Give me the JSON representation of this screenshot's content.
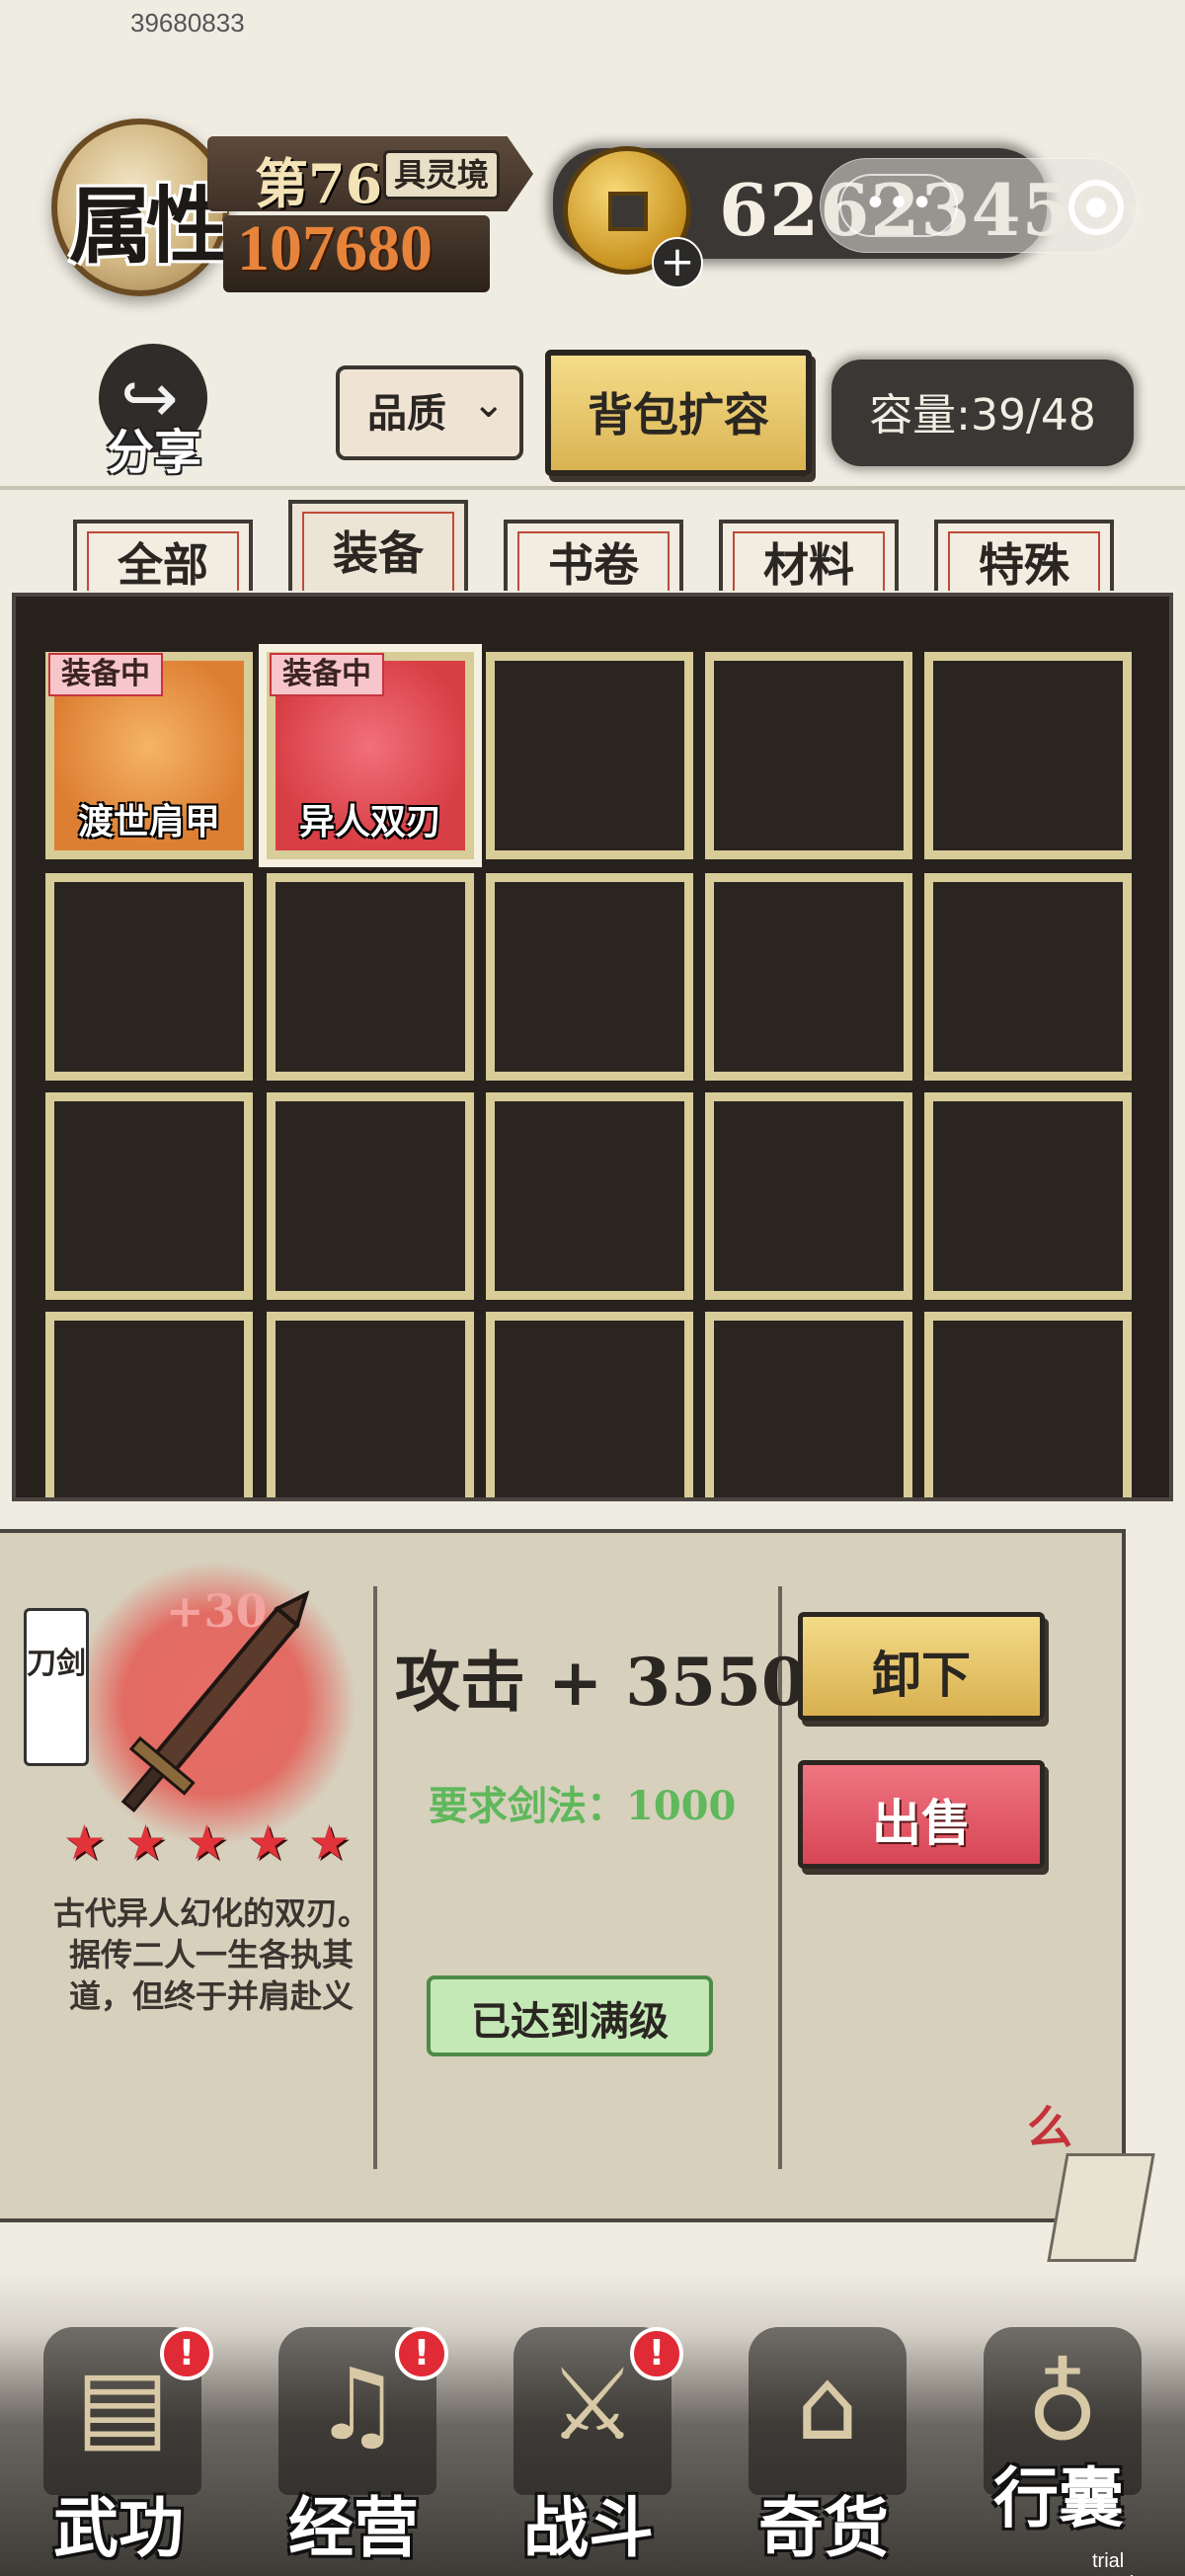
{
  "uid": "39680833",
  "header": {
    "attr_label": "属性",
    "level": "第76",
    "realm": "具灵境",
    "power": "107680",
    "coins": "62623455·",
    "coin_plus": "+",
    "mini_program": {
      "dots": "•••"
    }
  },
  "toolbar": {
    "share_label": "分享",
    "quality_label": "品质",
    "expand_label": "背包扩容",
    "capacity_label": "容量:39/48"
  },
  "tabs": [
    {
      "label": "全部"
    },
    {
      "label": "装备",
      "active": true
    },
    {
      "label": "书卷"
    },
    {
      "label": "材料"
    },
    {
      "label": "特殊"
    }
  ],
  "inventory": {
    "items": [
      {
        "name": "渡世肩甲",
        "badge": "装备中",
        "icon": "armor-icon"
      },
      {
        "name": "异人双刃",
        "badge": "装备中",
        "icon": "blade-icon"
      }
    ]
  },
  "detail": {
    "type_tag": "刀剑",
    "enhance": "+30",
    "stars": 5,
    "description": "古代异人幻化的双刃。据传二人一生各执其道，但终于并肩赴义",
    "attack": "攻击 + 3550",
    "requirement": "要求剑法：1000",
    "max_level": "已达到满级",
    "unequip_label": "卸下",
    "sell_label": "出售",
    "lock_glyph": "么"
  },
  "nav": [
    {
      "label": "武功",
      "icon": "scroll-icon",
      "alert": "!"
    },
    {
      "label": "经营",
      "icon": "musician-icon",
      "alert": "!"
    },
    {
      "label": "战斗",
      "icon": "warrior-icon",
      "alert": "!"
    },
    {
      "label": "奇货",
      "icon": "shop-icon"
    },
    {
      "label": "行囊",
      "icon": "bag-icon"
    }
  ],
  "footer": {
    "trial": "trial version"
  },
  "colors": {
    "background": "#efece2",
    "grid_frame": "#d8cc98",
    "power": "#e7843b",
    "sell": "#d74555",
    "unequip": "#f4da88",
    "requirement": "#5fb85b"
  }
}
